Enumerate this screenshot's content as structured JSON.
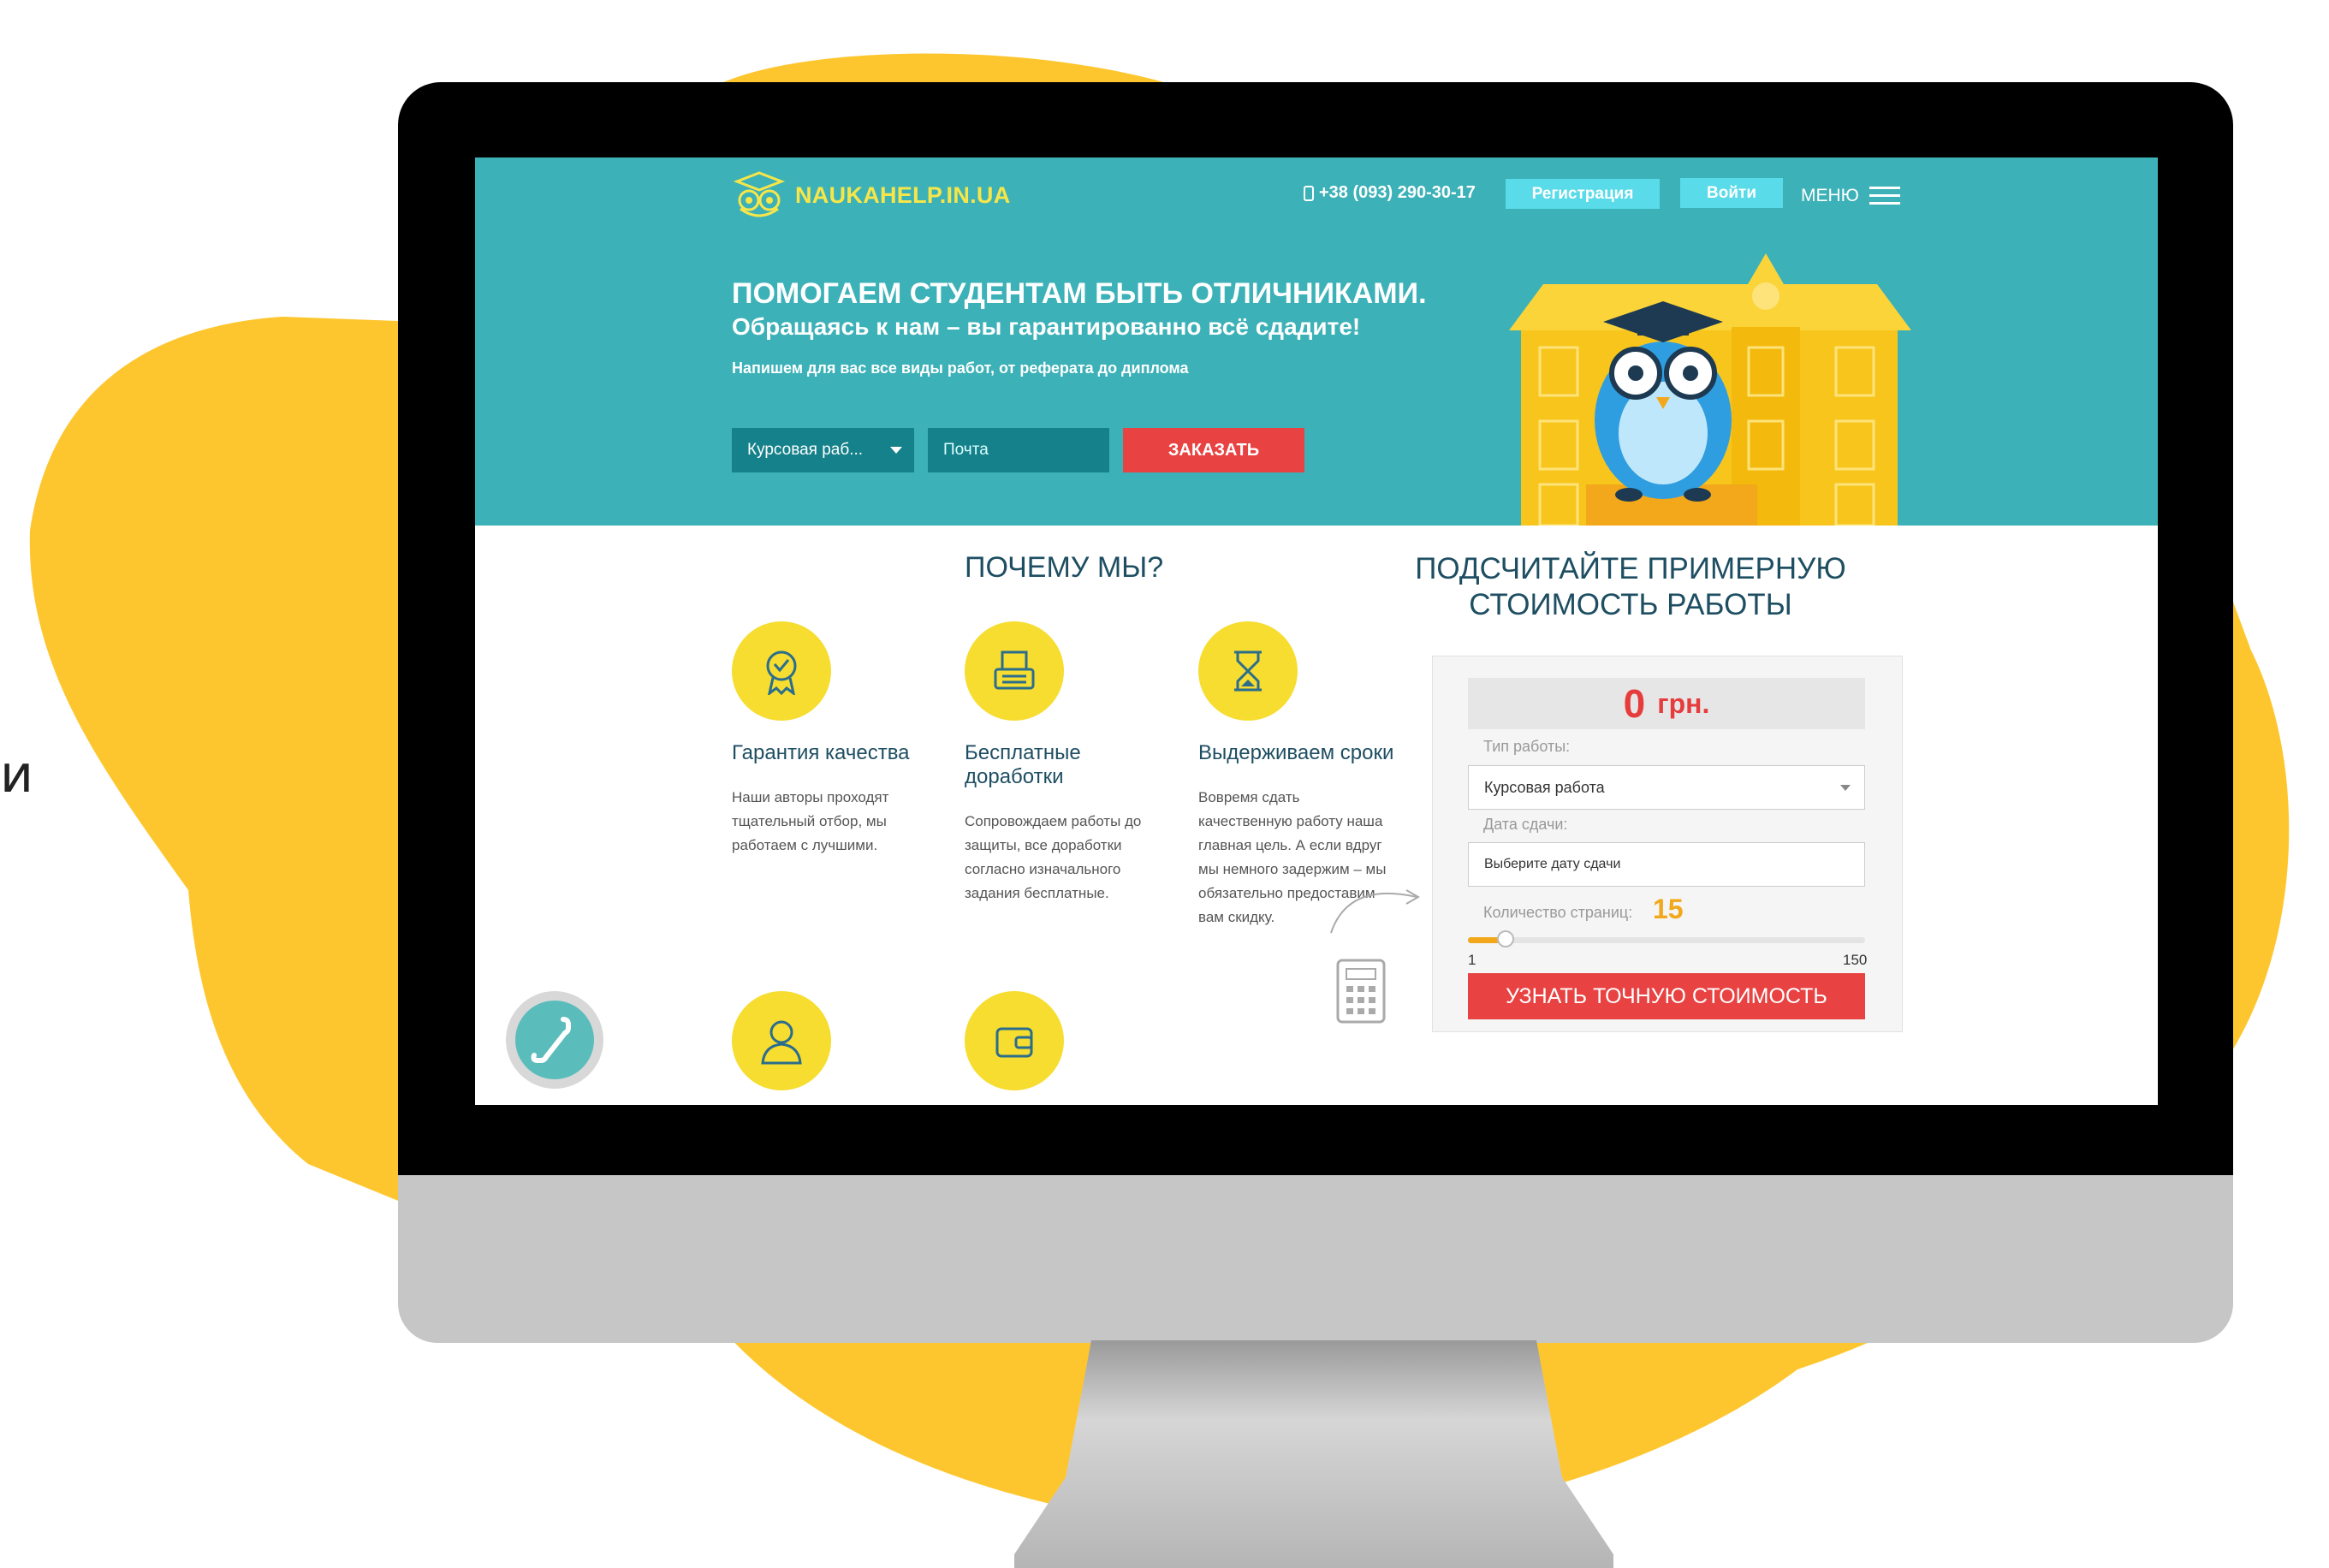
{
  "background": {
    "accent": "#fec62e"
  },
  "edge_text": "и",
  "site": {
    "logo_text": "NAUKAHELP.IN.UA",
    "phone": "+38 (093) 290-30-17",
    "register_label": "Регистрация",
    "login_label": "Войти",
    "menu_label": "МЕНЮ",
    "colors": {
      "hero": "#3cb1b7",
      "button": "#59dbe9",
      "order": "#e84242",
      "dark_field": "#15818a",
      "feature": "#f6dd30"
    }
  },
  "hero": {
    "headline": "ПОМОГАЕМ СТУДЕНТАМ БЫТЬ ОТЛИЧНИКАМИ.",
    "subheadline": "Обращаясь к нам – вы гарантированно всё сдадите!",
    "tagline": "Напишем для вас все виды работ, от реферата до диплома",
    "work_type_value": "Курсовая раб...",
    "email_placeholder": "Почта",
    "order_label": "ЗАКАЗАТЬ"
  },
  "why": {
    "title": "ПОЧЕМУ МЫ?",
    "features": [
      {
        "title": "Гарантия качества",
        "text": "Наши авторы проходят тщательный отбор, мы работаем с лучшими.",
        "icon": "certificate-icon"
      },
      {
        "title": "Бесплатные доработки",
        "text": "Сопровождаем работы до защиты, все доработки согласно изначального задания бесплатные.",
        "icon": "typewriter-icon"
      },
      {
        "title": "Выдерживаем сроки",
        "text": "Вовремя сдать качественную работу наша главная цель. А если вдруг мы немного задержим – мы обязательно предоставим вам скидку.",
        "icon": "hourglass-icon"
      }
    ],
    "next_row_icons": [
      "user-icon",
      "wallet-icon"
    ]
  },
  "calculator": {
    "title": "ПОДСЧИТАЙТЕ ПРИМЕРНУЮ СТОИМОСТЬ РАБОТЫ",
    "price_value": "0",
    "price_unit": "грн.",
    "type_label": "Тип работы:",
    "type_value": "Курсовая работа",
    "date_label": "Дата сдачи:",
    "date_placeholder": "Выберите дату сдачи",
    "pages_label": "Количество страниц:",
    "pages_value": "15",
    "pages_min": "1",
    "pages_max": "150",
    "pages_fraction": 0.094,
    "cta_label": "УЗНАТЬ ТОЧНУЮ СТОИМОСТЬ"
  },
  "call_widget": {
    "icon": "phone-icon"
  }
}
